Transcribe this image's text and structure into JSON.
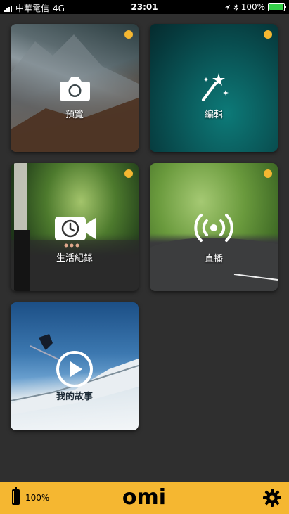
{
  "status_bar": {
    "carrier": "中華電信",
    "network": "4G",
    "time": "23:01",
    "battery_percent": "100%",
    "icons": [
      "signal-icon",
      "location-arrow-icon",
      "bluetooth-icon",
      "battery-icon"
    ]
  },
  "tiles": {
    "preview": {
      "label": "預覽",
      "icon": "camera-icon",
      "badge": true
    },
    "edit": {
      "label": "編輯",
      "icon": "magic-wand-icon",
      "badge": true
    },
    "timelapse": {
      "label": "生活紀錄",
      "icon": "clock-video-icon",
      "badge": true
    },
    "live": {
      "label": "直播",
      "icon": "broadcast-icon",
      "badge": true
    },
    "story": {
      "label": "我的故事",
      "icon": "play-icon",
      "badge": false
    }
  },
  "bottom_bar": {
    "battery_level": "100%",
    "logo_text": "omi",
    "settings_icon": "gear-icon"
  },
  "colors": {
    "accent": "#f5b731",
    "background": "#2f2f2f",
    "status_bar": "#000000",
    "battery_green": "#35d04a"
  }
}
